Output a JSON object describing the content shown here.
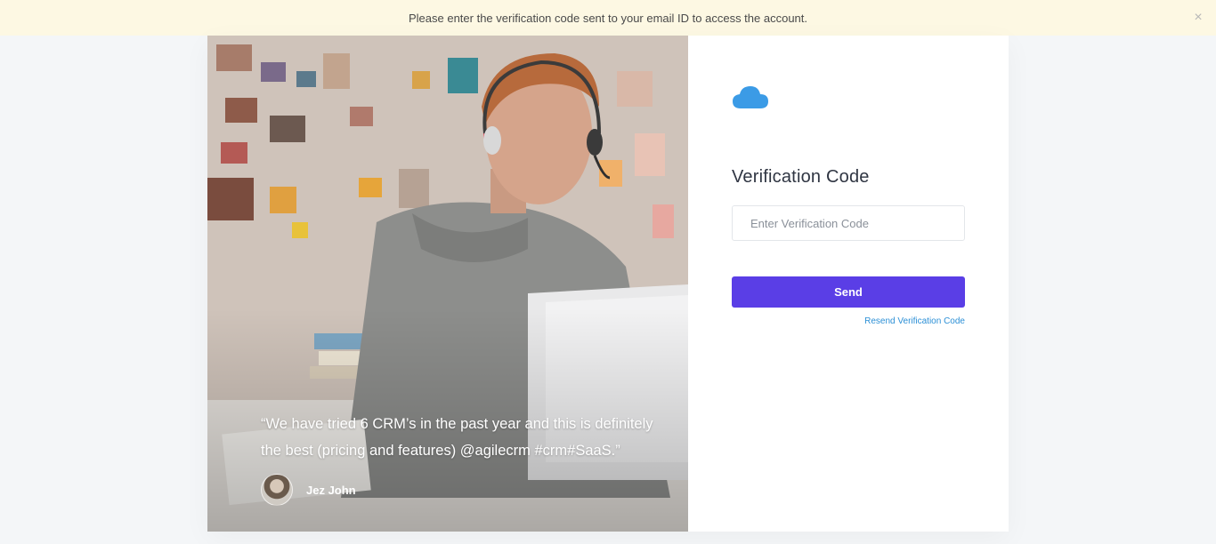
{
  "banner": {
    "message": "Please enter the verification code sent to your email ID to access the account.",
    "close_glyph": "×"
  },
  "testimonial": {
    "quote": "“We have tried 6 CRM’s in the past year and this is definitely the best (pricing and features) @agilecrm #crm#SaaS.”",
    "author": "Jez John"
  },
  "form": {
    "logo_icon": "cloud-icon",
    "title": "Verification Code",
    "code_placeholder": "Enter Verification Code",
    "code_value": "",
    "send_label": "Send",
    "resend_label": "Resend Verification Code"
  },
  "colors": {
    "accent": "#5a3ee6",
    "link": "#2b8fd6",
    "logo": "#3b9be6",
    "banner_bg": "#fdf8e3"
  }
}
